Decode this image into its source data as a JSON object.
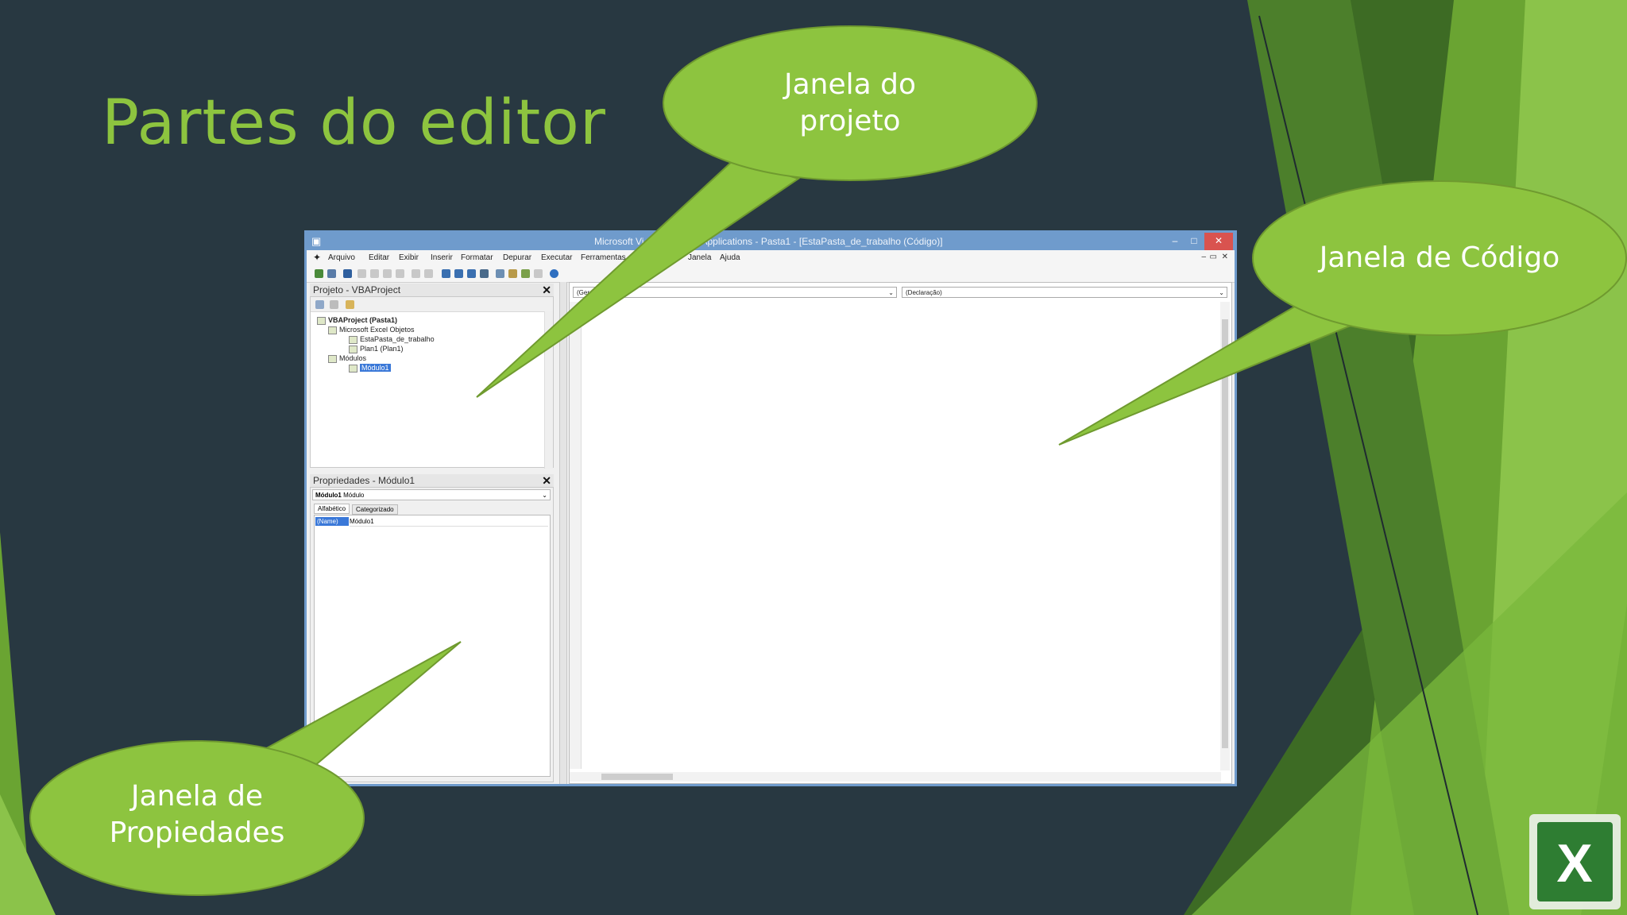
{
  "slide": {
    "title": "Partes do editor"
  },
  "callouts": {
    "project": {
      "line1": "Janela do",
      "line2": "projeto"
    },
    "code": {
      "line1": "Janela de Código"
    },
    "properties": {
      "line1": "Janela de",
      "line2": "Propiedades"
    }
  },
  "vbe": {
    "title_left": "Microsoft Vi",
    "title_right": "Applications - Pasta1 - [EstaPasta_de_trabalho (Código)]",
    "menu": [
      "Arquivo",
      "Editar",
      "Exibir",
      "Inserir",
      "Formatar",
      "Depurar",
      "Executar",
      "Ferramentas",
      "Janela",
      "Ajuda"
    ],
    "project_panel": {
      "title": "Projeto - VBAProject",
      "tree": [
        "VBAProject (Pasta1)",
        "Microsoft Excel Objetos",
        "EstaPasta_de_trabalho",
        "Plan1 (Plan1)",
        "Módulos",
        "Módulo1"
      ]
    },
    "properties_panel": {
      "title": "Propriedades - Módulo1",
      "object_name": "Módulo1",
      "object_type": "Módulo",
      "tab_alpha": "Alfabético",
      "tab_cat": "Categorizado",
      "prop_name": "(Name)",
      "prop_value": "Módulo1"
    },
    "code_panel": {
      "object_combo": "(Geral)",
      "proc_combo": "(Declaração)"
    }
  },
  "colors": {
    "accent": "#8dc43f",
    "background": "#283841",
    "callout": "#8dc43f"
  },
  "icons": {
    "excel_logo": "excel-logo-icon"
  }
}
